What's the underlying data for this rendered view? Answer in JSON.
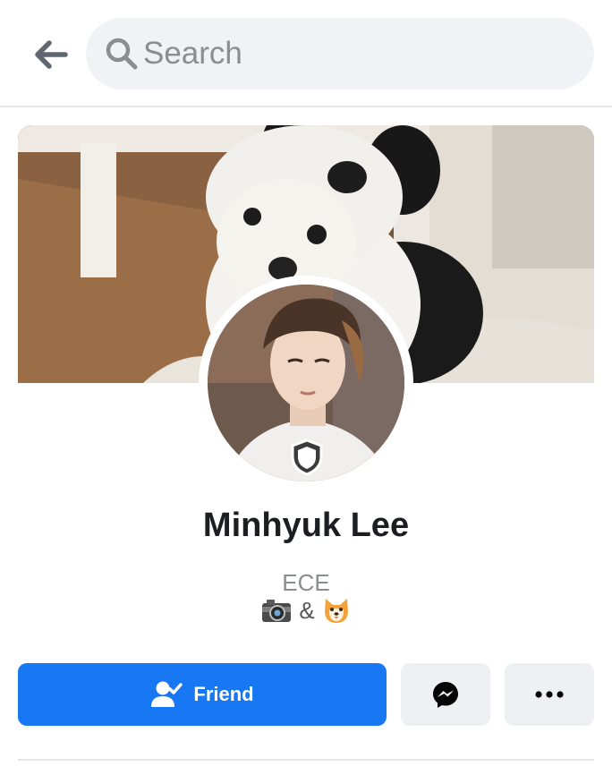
{
  "header": {
    "search_placeholder": "Search"
  },
  "profile": {
    "name": "Minhyuk Lee",
    "bio_line1": "ECE",
    "bio_line2_joiner": "&",
    "bio_emojis": [
      "camera-emoji",
      "shiba-dog-emoji"
    ]
  },
  "actions": {
    "friend_label": "Friend",
    "icons": [
      "messenger-icon",
      "more-icon"
    ]
  },
  "colors": {
    "primary": "#1877f2",
    "search_bg": "#f0f2f5",
    "button_gray": "#eef0f3",
    "text_dark": "#1c1e21",
    "text_muted": "#8a8d91"
  }
}
